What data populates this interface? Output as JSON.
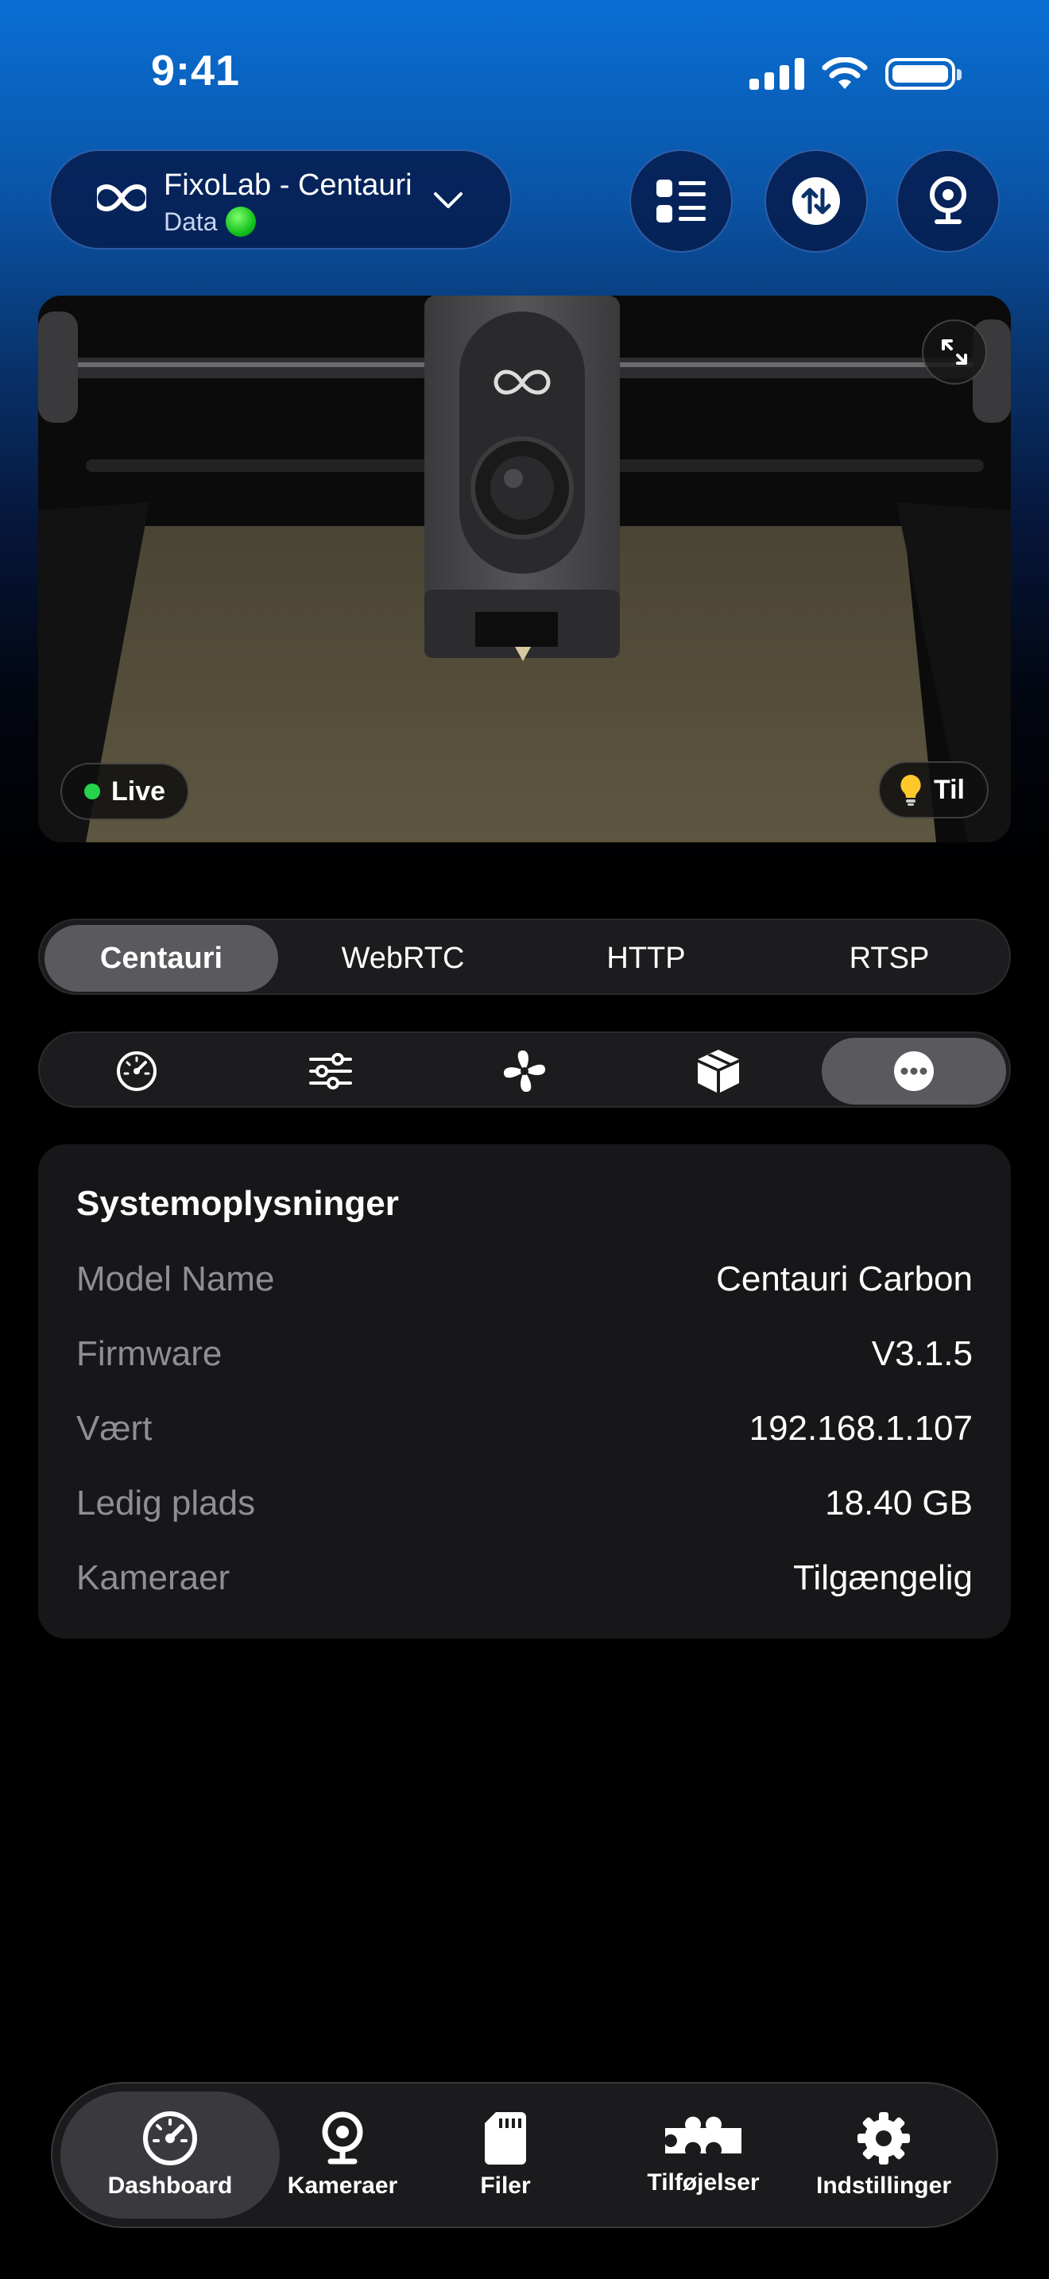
{
  "status_bar": {
    "time": "9:41"
  },
  "printer": {
    "name": "FixoLab - Centauri",
    "sub_label": "Data"
  },
  "header_buttons": [
    "list-icon",
    "transfer-icon",
    "webcam-icon"
  ],
  "camera": {
    "live_label": "Live",
    "light_label": "Til"
  },
  "stream_sources": {
    "options": [
      "Centauri",
      "WebRTC",
      "HTTP",
      "RTSP"
    ],
    "selected": "Centauri"
  },
  "panel_tabs": {
    "icons": [
      "gauge-icon",
      "sliders-icon",
      "fan-icon",
      "box-icon",
      "more-icon"
    ],
    "selected": "more-icon"
  },
  "system_info": {
    "title": "Systemoplysninger",
    "rows": [
      {
        "label": "Model Name",
        "value": "Centauri Carbon"
      },
      {
        "label": "Firmware",
        "value": "V3.1.5"
      },
      {
        "label": "Vært",
        "value": "192.168.1.107"
      },
      {
        "label": "Ledig plads",
        "value": "18.40 GB"
      },
      {
        "label": "Kameraer",
        "value": "Tilgængelig"
      }
    ]
  },
  "bottom_nav": {
    "items": [
      {
        "label": "Dashboard",
        "icon": "gauge-icon"
      },
      {
        "label": "Kameraer",
        "icon": "webcam-icon"
      },
      {
        "label": "Filer",
        "icon": "sd-card-icon"
      },
      {
        "label": "Tilføjelser",
        "icon": "puzzle-icon"
      },
      {
        "label": "Indstillinger",
        "icon": "gear-icon"
      }
    ],
    "selected": "Dashboard"
  },
  "colors": {
    "accent": "#0a6fd4",
    "live": "#27d34a",
    "status_ok": "#14c21d",
    "card": "#17171a"
  }
}
